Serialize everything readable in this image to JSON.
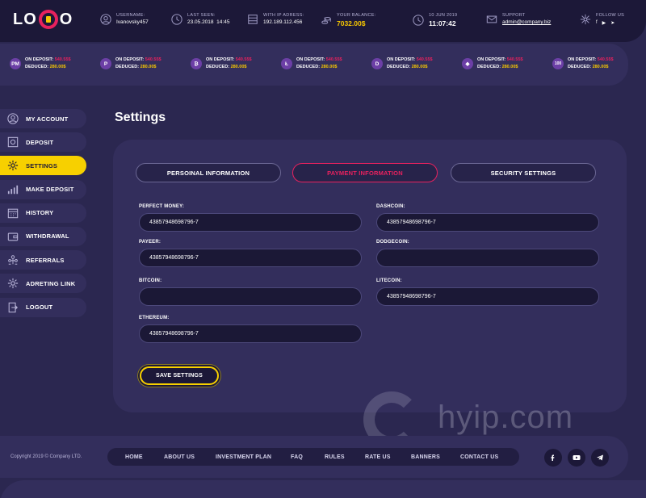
{
  "header": {
    "logo_left": "LO",
    "logo_right": "O",
    "username_label": "USERNAME:",
    "username": "Ivanovsky457",
    "last_seen_label": "LAST SEEN:",
    "last_seen_date": "23.05.2018",
    "last_seen_time": "14:45",
    "ip_label": "WITH IP ADRESS:",
    "ip": "192.189.112.456",
    "balance_label": "YOUR BALANCE:",
    "balance": "7032.00$",
    "date": "10 JUN 2019",
    "time": "11:07:42",
    "support_label": "SUPPORT",
    "support_email": "admin@company.biz",
    "follow_label": "FOLLOW US",
    "social": [
      "f",
      "▶",
      "➤"
    ]
  },
  "deposits": [
    {
      "coin": "PM",
      "label": "ON DEPOSIT:",
      "amount": "540.55$",
      "deducted_label": "DEDUCED:",
      "deducted": "280.00$"
    },
    {
      "coin": "P",
      "label": "ON DEPOSIT:",
      "amount": "540.55$",
      "deducted_label": "DEDUCED:",
      "deducted": "280.00$"
    },
    {
      "coin": "₿",
      "label": "ON DEPOSIT:",
      "amount": "540.55$",
      "deducted_label": "DEDUCED:",
      "deducted": "280.00$"
    },
    {
      "coin": "Ł",
      "label": "ON DEPOSIT:",
      "amount": "540.55$",
      "deducted_label": "DEDUCED:",
      "deducted": "280.00$"
    },
    {
      "coin": "D",
      "label": "ON DEPOSIT:",
      "amount": "540.55$",
      "deducted_label": "DEDUCED:",
      "deducted": "280.00$"
    },
    {
      "coin": "◆",
      "label": "ON DEPOSIT:",
      "amount": "540.55$",
      "deducted_label": "DEDUCED:",
      "deducted": "280.00$"
    },
    {
      "coin": "100",
      "label": "ON DEPOSIT:",
      "amount": "540.55$",
      "deducted_label": "DEDUCED:",
      "deducted": "280.00$"
    }
  ],
  "sidebar": {
    "items": [
      {
        "label": "MY ACCOUNT",
        "icon": "user-icon"
      },
      {
        "label": "DEPOSIT",
        "icon": "safe-icon"
      },
      {
        "label": "SETTINGS",
        "icon": "gear-icon"
      },
      {
        "label": "MAKE DEPOSIT",
        "icon": "chart-icon"
      },
      {
        "label": "HISTORY",
        "icon": "calendar-icon"
      },
      {
        "label": "WITHDRAWAL",
        "icon": "wallet-icon"
      },
      {
        "label": "REFERRALS",
        "icon": "people-icon"
      },
      {
        "label": "ADRETING LINK",
        "icon": "link-icon"
      },
      {
        "label": "LOGOUT",
        "icon": "logout-icon"
      }
    ]
  },
  "page": {
    "title": "Settings"
  },
  "tabs": [
    {
      "label": "PERSOINAL INFORMATION"
    },
    {
      "label": "PAYMENT INFORMATION"
    },
    {
      "label": "SECURITY SETTINGS"
    }
  ],
  "form": {
    "perfect_money": {
      "label": "PERFECT MONEY:",
      "value": "43857948698796-7"
    },
    "payeer": {
      "label": "PAYEER:",
      "value": "43857948698796-7"
    },
    "bitcoin": {
      "label": "BITCOIN:",
      "value": ""
    },
    "ethereum": {
      "label": "ETHEREUM:",
      "value": "43857948698796-7"
    },
    "dashcoin": {
      "label": "DASHCOIN:",
      "value": "43857948698796-7"
    },
    "dodgecoin": {
      "label": "DODGECOIN:",
      "value": ""
    },
    "litecoin": {
      "label": "LITECOIN:",
      "value": "43857948698796-7"
    },
    "save_label": "SAVE SETTINGS"
  },
  "watermark": {
    "text": "hyip.com"
  },
  "footer": {
    "copyright": "Copyright 2019 © Company LTD.",
    "nav": [
      "HOME",
      "ABOUT US",
      "INVESTMENT PLAN",
      "FAQ",
      "RULES",
      "RATE US",
      "BANNERS",
      "CONTACT US"
    ]
  },
  "colors": {
    "accent_yellow": "#f7d000",
    "accent_pink": "#e8215e",
    "bg": "#2b2750",
    "panel": "#332e5c"
  }
}
